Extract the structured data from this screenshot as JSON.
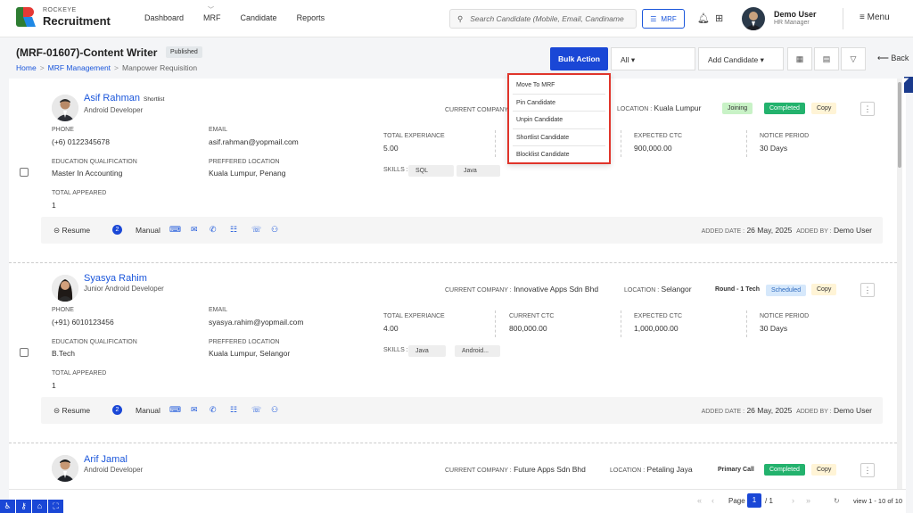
{
  "brand": {
    "line1": "ROCKEYE",
    "line2": "Recruitment"
  },
  "nav": {
    "items": [
      "Dashboard",
      "MRF",
      "Candidate",
      "Reports"
    ]
  },
  "search": {
    "placeholder": "Search Candidate (Mobile, Email, Candiname"
  },
  "mrf_button": "MRF",
  "user": {
    "name": "Demo User",
    "role": "HR Manager"
  },
  "menu_label": "Menu",
  "page": {
    "title": "(MRF-01607)-Content Writer",
    "status": "Published",
    "breadcrumb": [
      "Home",
      "MRF Management",
      "Manpower Requisition"
    ]
  },
  "toolbar": {
    "bulk": "Bulk Action",
    "all": "All",
    "add_candidate": "Add Candidate",
    "back": "Back"
  },
  "dropdown": [
    "Move To MRF",
    "Pin Candidate",
    "Unpin Candidate",
    "Shortlist Candidate",
    "Blocklist Candidate"
  ],
  "labels": {
    "phone": "PHONE",
    "email": "EMAIL",
    "education": "EDUCATION QUALIFICATION",
    "pref_location": "PREFFERED LOCATION",
    "total_appeared": "TOTAL APPEARED",
    "total_exp": "TOTAL EXPERIANCE",
    "current_ctc": "CURRENT CTC",
    "expected_ctc": "EXPECTED CTC",
    "notice": "NOTICE PERIOD",
    "skills": "SKILLS :",
    "current_company": "CURRENT COMPANY :",
    "location": "LOCATION :",
    "resume": "Resume",
    "manual": "Manual",
    "added_date": "ADDED DATE :",
    "added_by": "ADDED BY :"
  },
  "candidates": [
    {
      "name": "Asif Rahman",
      "tag": "Shortlist",
      "role": "Android Developer",
      "company": "",
      "location": "Kuala Lumpur",
      "phone": "(+6) 0122345678",
      "email": "asif.rahman@yopmail.com",
      "education": "Master In Accounting",
      "pref_location": "Kuala Lumpur, Penang",
      "total_appeared": "1",
      "total_exp": "5.00",
      "current_ctc": "",
      "expected_ctc": "900,000.00",
      "notice": "30 Days",
      "skills": [
        "SQL",
        "Java"
      ],
      "badges": [
        "Joining",
        "Completed",
        "Copy"
      ],
      "resume_count": "2",
      "added_date": "26 May, 2025",
      "added_by": "Demo User"
    },
    {
      "name": "Syasya Rahim",
      "tag": "",
      "role": "Junior Android Developer",
      "company": "Innovative Apps Sdn Bhd",
      "location": "Selangor",
      "phone": "(+91) 6010123456",
      "email": "syasya.rahim@yopmail.com",
      "education": "B.Tech",
      "pref_location": "Kuala Lumpur, Selangor",
      "total_appeared": "1",
      "total_exp": "4.00",
      "current_ctc": "800,000.00",
      "expected_ctc": "1,000,000.00",
      "notice": "30 Days",
      "skills": [
        "Java",
        "Android..."
      ],
      "badges": [
        "Round - 1 Tech",
        "Scheduled",
        "Copy"
      ],
      "resume_count": "2",
      "added_date": "26 May, 2025",
      "added_by": "Demo User"
    },
    {
      "name": "Arif Jamal",
      "tag": "",
      "role": "Android Developer",
      "company": "Future Apps Sdn Bhd",
      "location": "Petaling Jaya",
      "badges": [
        "Primary Call",
        "Completed",
        "Copy"
      ]
    }
  ],
  "pagination": {
    "page_label": "Page",
    "current": "1",
    "of": "/ 1",
    "view": "view 1 - 10 of 10"
  }
}
